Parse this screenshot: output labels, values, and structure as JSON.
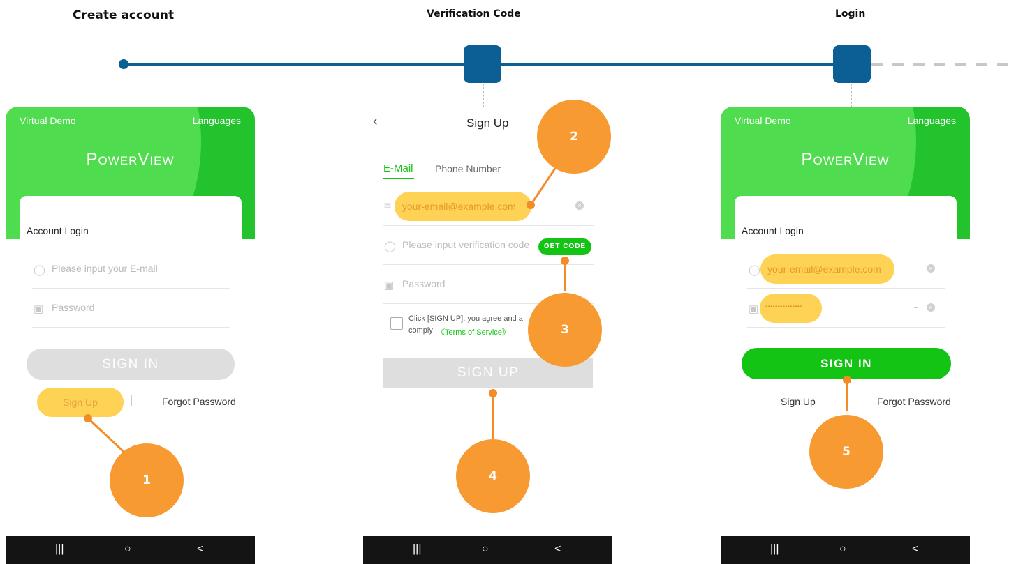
{
  "steps": {
    "create": "Create account",
    "verify": "Verification Code",
    "login": "Login"
  },
  "screen1": {
    "virtual_demo": "Virtual Demo",
    "languages": "Languages",
    "logo": "PowerView",
    "card_title": "Account Login",
    "email_placeholder": "Please input your E-mail",
    "password_placeholder": "Password",
    "sign_in": "SIGN IN",
    "sign_up": "Sign Up",
    "forgot": "Forgot Password"
  },
  "screen2": {
    "title": "Sign Up",
    "tab_email": "E-Mail",
    "tab_phone": "Phone Number",
    "email_value": "your-email@example.com",
    "code_placeholder": "Please input verification code",
    "get_code": "GET CODE",
    "password_placeholder": "Password",
    "terms_text": "Click [SIGN UP], you agree and a",
    "terms_text2": "comply",
    "terms_link": "《Terms of Service》",
    "sign_up": "SIGN UP"
  },
  "screen3": {
    "virtual_demo": "Virtual Demo",
    "languages": "Languages",
    "logo": "PowerView",
    "card_title": "Account Login",
    "email_value": "your-email@example.com",
    "password_value": "•••••••••••••••",
    "sign_in": "SIGN IN",
    "sign_up": "Sign Up",
    "forgot": "Forgot Password"
  },
  "callouts": [
    "1",
    "2",
    "3",
    "4",
    "5"
  ],
  "nav": {
    "recent": "|||",
    "home": "○",
    "back": "<"
  },
  "colors": {
    "brand_green": "#14c414",
    "timeline_blue": "#0b5f95",
    "callout_orange": "#f79a32",
    "highlight_yellow": "#fdd255"
  }
}
